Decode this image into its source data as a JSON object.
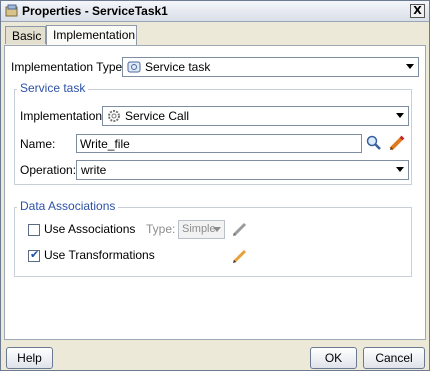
{
  "window": {
    "title": "Properties - ServiceTask1",
    "close_label": "X"
  },
  "tabs": [
    {
      "label": "Basic",
      "active": false
    },
    {
      "label": "Implementation",
      "active": true
    }
  ],
  "implementation_type": {
    "label": "Implementation Type:",
    "value": "Service task",
    "icon": "service-task-icon"
  },
  "service_task": {
    "title": "Service task",
    "implementation": {
      "label": "Implementation:",
      "value": "Service Call",
      "icon": "gear-icon"
    },
    "name": {
      "label": "Name:",
      "value": "Write_file"
    },
    "operation": {
      "label": "Operation:",
      "value": "write"
    }
  },
  "data_associations": {
    "title": "Data Associations",
    "use_associations": {
      "label": "Use Associations",
      "checked": false
    },
    "type": {
      "label": "Type:",
      "value": "Simple"
    },
    "use_transformations": {
      "label": "Use Transformations",
      "checked": true
    }
  },
  "buttons": {
    "help": "Help",
    "ok": "OK",
    "cancel": "Cancel"
  },
  "colors": {
    "group_title": "#2d52a5",
    "panel_bg": "#ffffff",
    "dialog_bg": "#ece9d8"
  }
}
